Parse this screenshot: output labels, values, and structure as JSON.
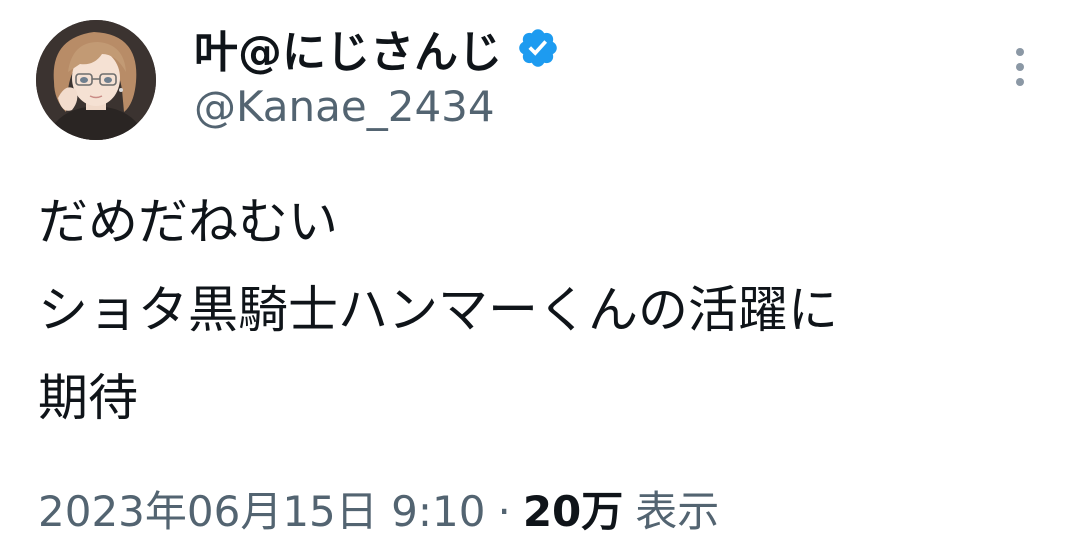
{
  "tweet": {
    "author": {
      "display_name": "叶@にじさんじ",
      "handle": "@Kanae_2434",
      "verified": true,
      "avatar_icon": "avatar-portrait"
    },
    "body_lines": [
      "だめだねむい",
      "ショタ黒騎士ハンマーくんの活躍に",
      "期待"
    ],
    "meta": {
      "timestamp": "2023年06月15日 9:10",
      "separator": "·",
      "views_count": "20万",
      "views_label": "表示"
    },
    "more_icon": "more-vertical-icon",
    "colors": {
      "text": "#0f1419",
      "secondary": "#536471",
      "verified_badge": "#1d9bf0"
    }
  }
}
